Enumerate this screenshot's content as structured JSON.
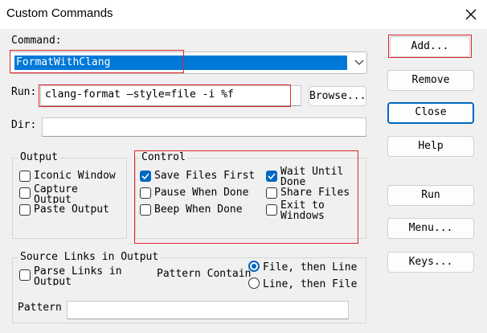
{
  "window": {
    "title": "Custom Commands"
  },
  "command": {
    "label": "Command:",
    "value": "FormatWithClang"
  },
  "run": {
    "label": "Run:",
    "value": "clang-format —style=file -i %f",
    "browse": "Browse..."
  },
  "dir": {
    "label": "Dir:",
    "value": ""
  },
  "output": {
    "title": "Output",
    "items": [
      {
        "label": "Iconic Window",
        "checked": false
      },
      {
        "label": "Capture Output",
        "checked": false
      },
      {
        "label": "Paste Output",
        "checked": false
      }
    ]
  },
  "control": {
    "title": "Control",
    "items": [
      {
        "label": "Save Files First",
        "checked": true
      },
      {
        "label": "Pause When Done",
        "checked": false
      },
      {
        "label": "Beep When Done",
        "checked": false
      },
      {
        "label": "Wait Until Done",
        "checked": true
      },
      {
        "label": "Share Files",
        "checked": false
      },
      {
        "label": "Exit to Windows",
        "checked": false
      }
    ]
  },
  "source_links": {
    "title": "Source Links in Output",
    "parse": "Parse Links in Output",
    "pattern_contain": "Pattern Contain",
    "radio_file_then_line": "File, then Line",
    "radio_line_then_file": "Line, then File",
    "pattern_label": "Pattern",
    "pattern_value": ""
  },
  "buttons": {
    "add": "Add...",
    "remove": "Remove",
    "close": "Close",
    "help": "Help",
    "run": "Run",
    "menu": "Menu...",
    "keys": "Keys..."
  },
  "colors": {
    "accent": "#0067c0",
    "selection": "#0078d7",
    "highlight_box": "#e0242b"
  }
}
